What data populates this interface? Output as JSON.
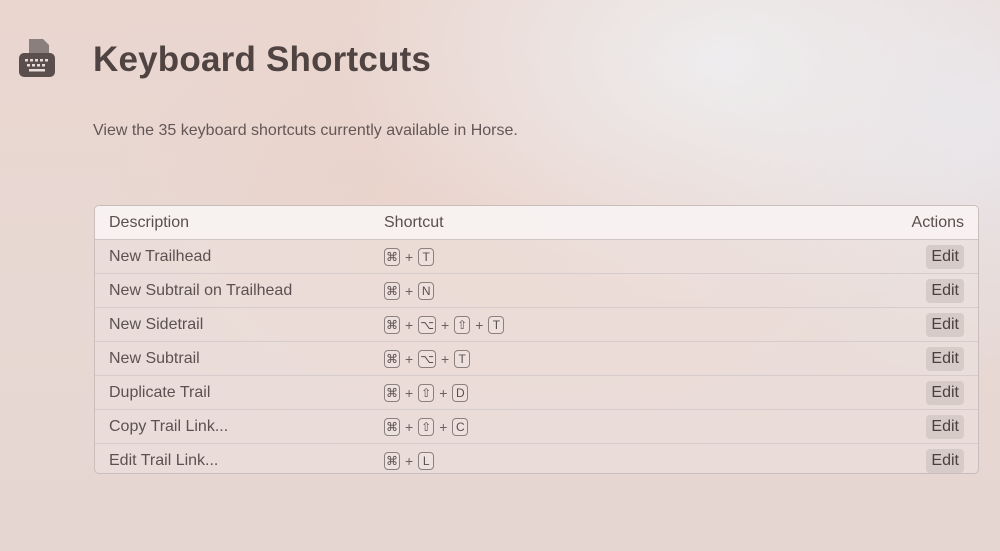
{
  "header": {
    "title": "Keyboard Shortcuts",
    "icon": "typewriter-icon"
  },
  "intro": {
    "text": "View the 35 keyboard shortcuts currently available in Horse."
  },
  "table": {
    "columns": {
      "description": "Description",
      "shortcut": "Shortcut",
      "actions": "Actions"
    },
    "rows": [
      {
        "description": "New Trailhead",
        "keys": [
          "⌘",
          "T"
        ],
        "action": "Edit"
      },
      {
        "description": "New Subtrail on Trailhead",
        "keys": [
          "⌘",
          "N"
        ],
        "action": "Edit"
      },
      {
        "description": "New Sidetrail",
        "keys": [
          "⌘",
          "⌥",
          "⇧",
          "T"
        ],
        "action": "Edit"
      },
      {
        "description": "New Subtrail",
        "keys": [
          "⌘",
          "⌥",
          "T"
        ],
        "action": "Edit"
      },
      {
        "description": "Duplicate Trail",
        "keys": [
          "⌘",
          "⇧",
          "D"
        ],
        "action": "Edit"
      },
      {
        "description": "Copy Trail Link...",
        "keys": [
          "⌘",
          "⇧",
          "C"
        ],
        "action": "Edit"
      },
      {
        "description": "Edit Trail Link...",
        "keys": [
          "⌘",
          "L"
        ],
        "action": "Edit"
      }
    ],
    "key_separator": "+"
  }
}
